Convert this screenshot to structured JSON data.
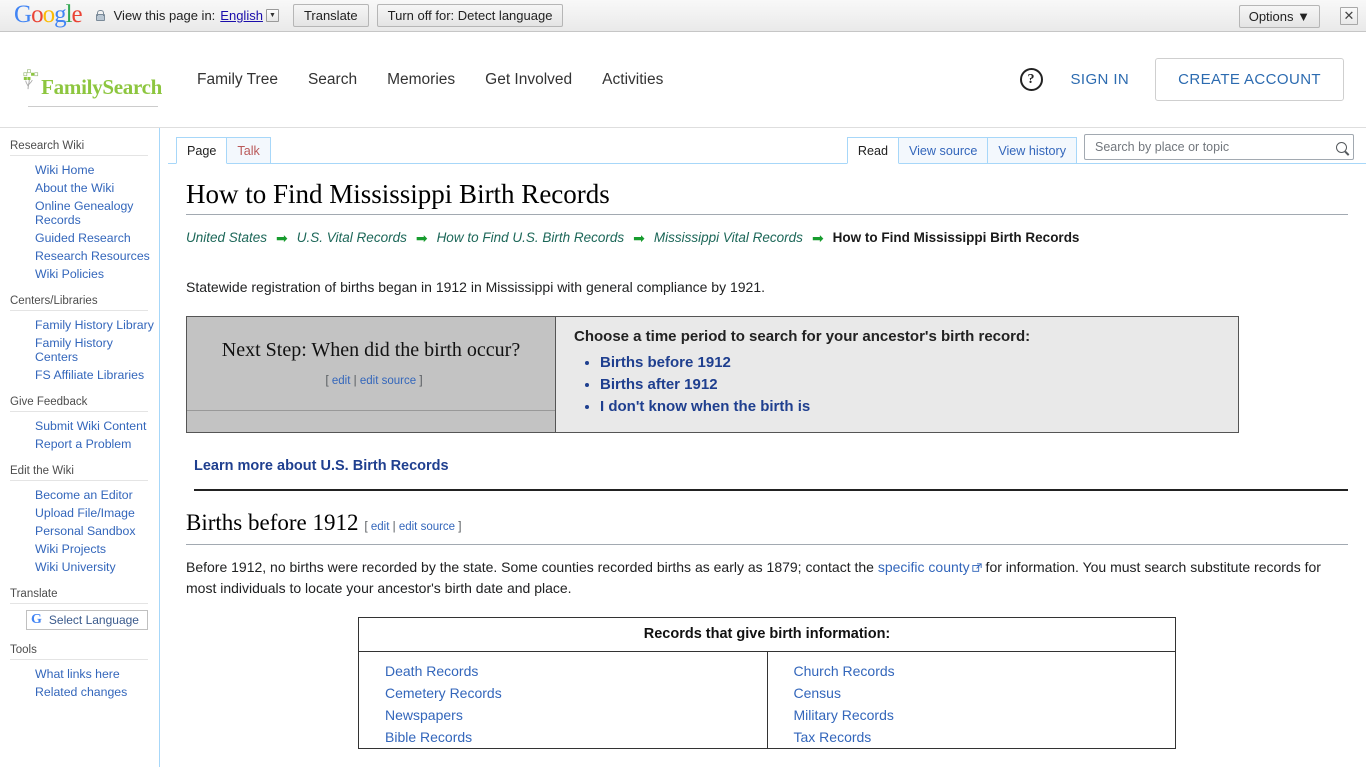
{
  "translate_bar": {
    "google_letters": [
      "G",
      "o",
      "o",
      "g",
      "l",
      "e"
    ],
    "lock_icon": "lock-icon",
    "view_label": "View this page in:",
    "language": "English",
    "translate_button": "Translate",
    "turn_off_button": "Turn off for: Detect language",
    "options_button": "Options ▼",
    "close_icon": "✕"
  },
  "header": {
    "logo_text": "FamilySearch",
    "nav": [
      {
        "label": "Family Tree"
      },
      {
        "label": "Search"
      },
      {
        "label": "Memories"
      },
      {
        "label": "Get Involved"
      },
      {
        "label": "Activities"
      }
    ],
    "help_icon": "?",
    "sign_in": "SIGN IN",
    "create_account": "CREATE ACCOUNT",
    "brand_green": "#8DC63F",
    "link_blue": "#2c6bb0"
  },
  "sidebar": {
    "sections": [
      {
        "heading": "Research Wiki",
        "items": [
          {
            "label": "Wiki Home"
          },
          {
            "label": "About the Wiki"
          },
          {
            "label": "Online Genealogy Records"
          },
          {
            "label": "Guided Research"
          },
          {
            "label": "Research Resources"
          },
          {
            "label": "Wiki Policies"
          }
        ]
      },
      {
        "heading": "Centers/Libraries",
        "items": [
          {
            "label": "Family History Library"
          },
          {
            "label": "Family History Centers"
          },
          {
            "label": "FS Affiliate Libraries"
          }
        ]
      },
      {
        "heading": "Give Feedback",
        "items": [
          {
            "label": "Submit Wiki Content"
          },
          {
            "label": "Report a Problem"
          }
        ]
      },
      {
        "heading": "Edit the Wiki",
        "items": [
          {
            "label": "Become an Editor"
          },
          {
            "label": "Upload File/Image"
          },
          {
            "label": "Personal Sandbox"
          },
          {
            "label": "Wiki Projects"
          },
          {
            "label": "Wiki University"
          }
        ]
      },
      {
        "heading": "Translate",
        "items": []
      },
      {
        "heading": "Tools",
        "items": [
          {
            "label": "What links here"
          },
          {
            "label": "Related changes"
          }
        ]
      }
    ],
    "select_language": {
      "icon": "G",
      "label": "Select Language"
    }
  },
  "tabs": {
    "left": [
      {
        "label": "Page",
        "state": "selected"
      },
      {
        "label": "Talk",
        "state": "newpage"
      }
    ],
    "right": [
      {
        "label": "Read",
        "state": "selected"
      },
      {
        "label": "View source",
        "state": "normal"
      },
      {
        "label": "View history",
        "state": "normal"
      }
    ]
  },
  "search": {
    "placeholder": "Search by place or topic",
    "value": "",
    "icon": "search-icon"
  },
  "article": {
    "title": "How to Find Mississippi Birth Records",
    "breadcrumb": [
      {
        "label": "United States",
        "current": false
      },
      {
        "label": "U.S. Vital Records",
        "current": false
      },
      {
        "label": "How to Find U.S. Birth Records",
        "current": false
      },
      {
        "label": "Mississippi Vital Records",
        "current": false
      },
      {
        "label": "How to Find Mississippi Birth Records",
        "current": true
      }
    ],
    "breadcrumb_arrow": "➡",
    "intro": "Statewide registration of births began in 1912 in Mississippi with general compliance by 1921.",
    "next_step_box": {
      "left_title": "Next Step: When did the birth occur?",
      "edit_open": "[",
      "edit_label": "edit",
      "edit_divider": "|",
      "edit_source_label": "edit source",
      "edit_close": "]",
      "prompt": "Choose a time period to search for your ancestor's birth record:",
      "options": [
        {
          "label": "Births before 1912"
        },
        {
          "label": "Births after 1912"
        },
        {
          "label": "I don't know when the birth is"
        }
      ]
    },
    "learn_more": "Learn more about U.S. Birth Records",
    "section": {
      "heading": "Births before 1912",
      "edit_open": "[",
      "edit_label": "edit",
      "edit_divider": "|",
      "edit_source_label": "edit source",
      "edit_close": "]",
      "para_part1": "Before 1912, no births were recorded by the state. Some counties recorded births as early as 1879; contact the ",
      "para_link": "specific county",
      "para_part2": " for information. You must search substitute records for most individuals to locate your ancestor's birth date and place."
    },
    "records_table": {
      "header": "Records that give birth information:",
      "left_column": [
        {
          "label": "Death Records"
        },
        {
          "label": "Cemetery Records"
        },
        {
          "label": "Newspapers"
        },
        {
          "label": "Bible Records"
        }
      ],
      "right_column": [
        {
          "label": "Church Records"
        },
        {
          "label": "Census"
        },
        {
          "label": "Military Records"
        },
        {
          "label": "Tax Records"
        }
      ]
    }
  }
}
